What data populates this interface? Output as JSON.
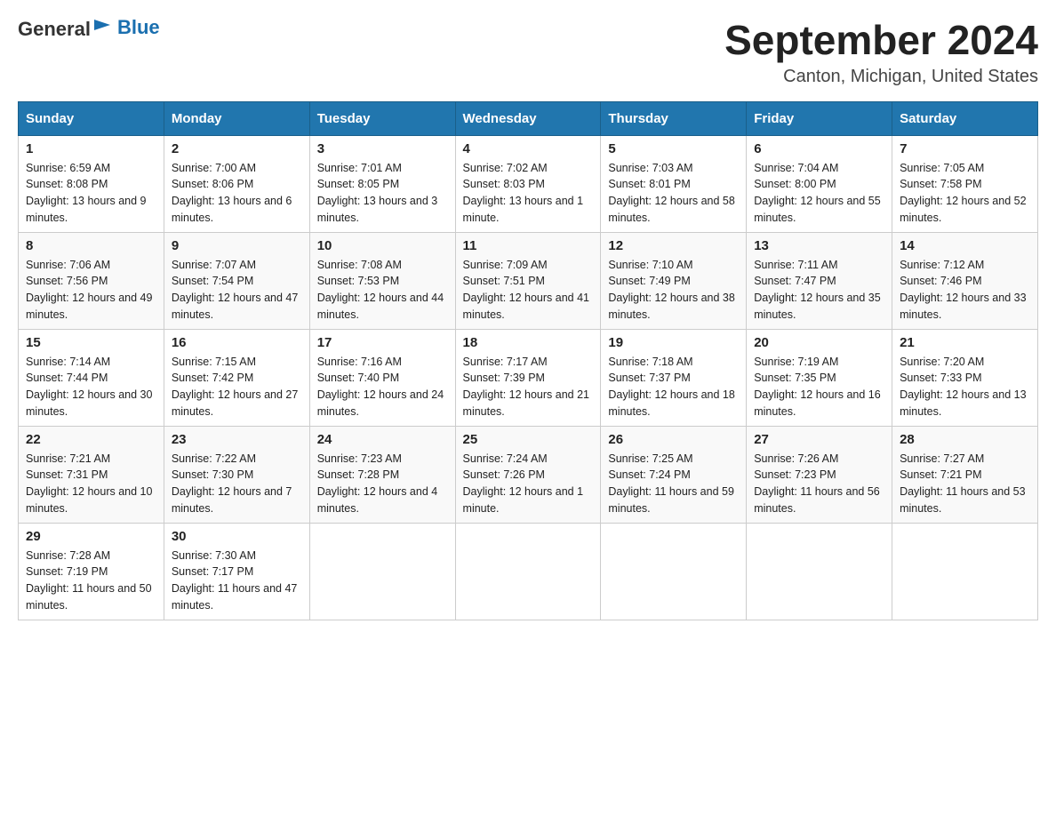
{
  "header": {
    "logo": {
      "general": "General",
      "blue": "Blue"
    },
    "title": "September 2024",
    "location": "Canton, Michigan, United States"
  },
  "days_of_week": [
    "Sunday",
    "Monday",
    "Tuesday",
    "Wednesday",
    "Thursday",
    "Friday",
    "Saturday"
  ],
  "weeks": [
    [
      {
        "day": "1",
        "sunrise": "6:59 AM",
        "sunset": "8:08 PM",
        "daylight": "13 hours and 9 minutes."
      },
      {
        "day": "2",
        "sunrise": "7:00 AM",
        "sunset": "8:06 PM",
        "daylight": "13 hours and 6 minutes."
      },
      {
        "day": "3",
        "sunrise": "7:01 AM",
        "sunset": "8:05 PM",
        "daylight": "13 hours and 3 minutes."
      },
      {
        "day": "4",
        "sunrise": "7:02 AM",
        "sunset": "8:03 PM",
        "daylight": "13 hours and 1 minute."
      },
      {
        "day": "5",
        "sunrise": "7:03 AM",
        "sunset": "8:01 PM",
        "daylight": "12 hours and 58 minutes."
      },
      {
        "day": "6",
        "sunrise": "7:04 AM",
        "sunset": "8:00 PM",
        "daylight": "12 hours and 55 minutes."
      },
      {
        "day": "7",
        "sunrise": "7:05 AM",
        "sunset": "7:58 PM",
        "daylight": "12 hours and 52 minutes."
      }
    ],
    [
      {
        "day": "8",
        "sunrise": "7:06 AM",
        "sunset": "7:56 PM",
        "daylight": "12 hours and 49 minutes."
      },
      {
        "day": "9",
        "sunrise": "7:07 AM",
        "sunset": "7:54 PM",
        "daylight": "12 hours and 47 minutes."
      },
      {
        "day": "10",
        "sunrise": "7:08 AM",
        "sunset": "7:53 PM",
        "daylight": "12 hours and 44 minutes."
      },
      {
        "day": "11",
        "sunrise": "7:09 AM",
        "sunset": "7:51 PM",
        "daylight": "12 hours and 41 minutes."
      },
      {
        "day": "12",
        "sunrise": "7:10 AM",
        "sunset": "7:49 PM",
        "daylight": "12 hours and 38 minutes."
      },
      {
        "day": "13",
        "sunrise": "7:11 AM",
        "sunset": "7:47 PM",
        "daylight": "12 hours and 35 minutes."
      },
      {
        "day": "14",
        "sunrise": "7:12 AM",
        "sunset": "7:46 PM",
        "daylight": "12 hours and 33 minutes."
      }
    ],
    [
      {
        "day": "15",
        "sunrise": "7:14 AM",
        "sunset": "7:44 PM",
        "daylight": "12 hours and 30 minutes."
      },
      {
        "day": "16",
        "sunrise": "7:15 AM",
        "sunset": "7:42 PM",
        "daylight": "12 hours and 27 minutes."
      },
      {
        "day": "17",
        "sunrise": "7:16 AM",
        "sunset": "7:40 PM",
        "daylight": "12 hours and 24 minutes."
      },
      {
        "day": "18",
        "sunrise": "7:17 AM",
        "sunset": "7:39 PM",
        "daylight": "12 hours and 21 minutes."
      },
      {
        "day": "19",
        "sunrise": "7:18 AM",
        "sunset": "7:37 PM",
        "daylight": "12 hours and 18 minutes."
      },
      {
        "day": "20",
        "sunrise": "7:19 AM",
        "sunset": "7:35 PM",
        "daylight": "12 hours and 16 minutes."
      },
      {
        "day": "21",
        "sunrise": "7:20 AM",
        "sunset": "7:33 PM",
        "daylight": "12 hours and 13 minutes."
      }
    ],
    [
      {
        "day": "22",
        "sunrise": "7:21 AM",
        "sunset": "7:31 PM",
        "daylight": "12 hours and 10 minutes."
      },
      {
        "day": "23",
        "sunrise": "7:22 AM",
        "sunset": "7:30 PM",
        "daylight": "12 hours and 7 minutes."
      },
      {
        "day": "24",
        "sunrise": "7:23 AM",
        "sunset": "7:28 PM",
        "daylight": "12 hours and 4 minutes."
      },
      {
        "day": "25",
        "sunrise": "7:24 AM",
        "sunset": "7:26 PM",
        "daylight": "12 hours and 1 minute."
      },
      {
        "day": "26",
        "sunrise": "7:25 AM",
        "sunset": "7:24 PM",
        "daylight": "11 hours and 59 minutes."
      },
      {
        "day": "27",
        "sunrise": "7:26 AM",
        "sunset": "7:23 PM",
        "daylight": "11 hours and 56 minutes."
      },
      {
        "day": "28",
        "sunrise": "7:27 AM",
        "sunset": "7:21 PM",
        "daylight": "11 hours and 53 minutes."
      }
    ],
    [
      {
        "day": "29",
        "sunrise": "7:28 AM",
        "sunset": "7:19 PM",
        "daylight": "11 hours and 50 minutes."
      },
      {
        "day": "30",
        "sunrise": "7:30 AM",
        "sunset": "7:17 PM",
        "daylight": "11 hours and 47 minutes."
      },
      null,
      null,
      null,
      null,
      null
    ]
  ]
}
